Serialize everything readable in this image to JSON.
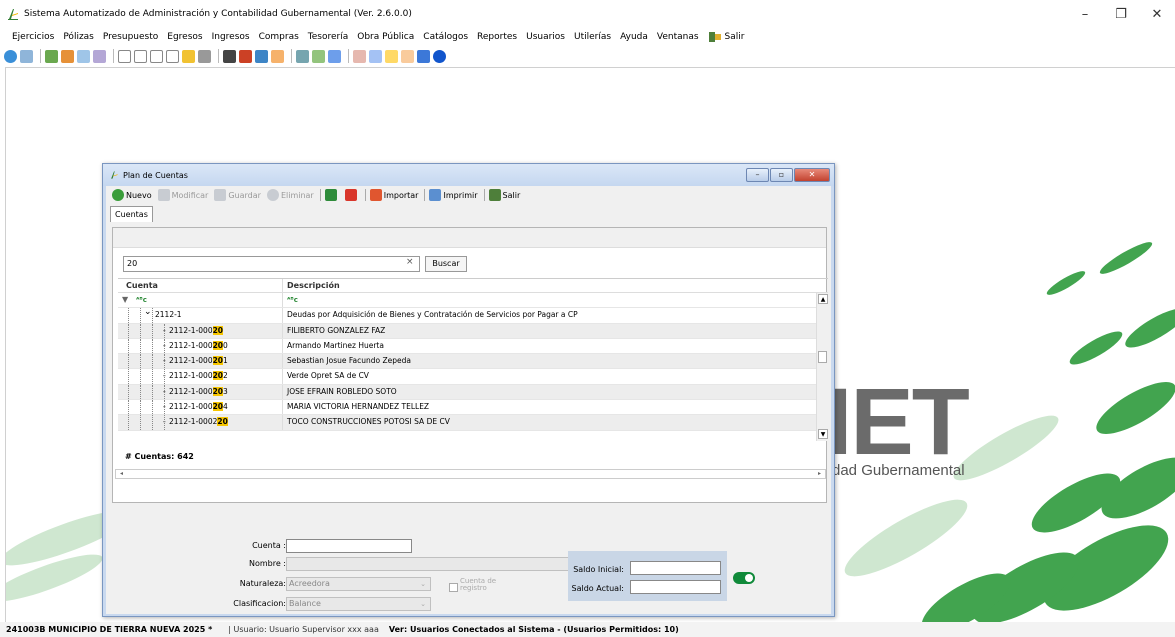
{
  "app": {
    "title": "Sistema Automatizado de Administración y Contabilidad Gubernamental (Ver. 2.6.0.0)"
  },
  "menu": {
    "items": [
      "Ejercicios",
      "Pólizas",
      "Presupuesto",
      "Egresos",
      "Ingresos",
      "Compras",
      "Tesorería",
      "Obra Pública",
      "Catálogos",
      "Reportes",
      "Usuarios",
      "Utilerías",
      "Ayuda",
      "Ventanas"
    ],
    "salir": "Salir"
  },
  "background": {
    "logo_text": "IET",
    "logo_sub": "dad Gubernamental"
  },
  "dialog": {
    "title": "Plan de Cuentas",
    "toolbar": {
      "nuevo": "Nuevo",
      "modificar": "Modificar",
      "guardar": "Guardar",
      "eliminar": "Eliminar",
      "importar": "Importar",
      "imprimir": "Imprimir",
      "salir": "Salir"
    },
    "tab": "Cuentas",
    "search": {
      "value": "20",
      "clear": "×",
      "button": "Buscar"
    },
    "grid": {
      "headers": [
        "Cuenta",
        "Descripción"
      ],
      "filter_cuenta": "ᴬ",
      "rows": [
        {
          "pre": "2112-1",
          "hl": "",
          "post": "",
          "desc": "Deudas por Adquisición de Bienes y Contratación de Servicios por Pagar a CP"
        },
        {
          "pre": "2112-1-000",
          "hl": "20",
          "post": "",
          "desc": "FILIBERTO GONZALEZ FAZ"
        },
        {
          "pre": "2112-1-000",
          "hl": "20",
          "post": "0",
          "desc": "Armando Martinez Huerta"
        },
        {
          "pre": "2112-1-000",
          "hl": "20",
          "post": "1",
          "desc": "Sebastian Josue Facundo Zepeda"
        },
        {
          "pre": "2112-1-000",
          "hl": "20",
          "post": "2",
          "desc": "Verde Opret SA de CV"
        },
        {
          "pre": "2112-1-000",
          "hl": "20",
          "post": "3",
          "desc": "JOSE EFRAIN ROBLEDO SOTO"
        },
        {
          "pre": "2112-1-000",
          "hl": "20",
          "post": "4",
          "desc": "MARIA VICTORIA HERNANDEZ TELLEZ"
        },
        {
          "pre": "2112-1-0002",
          "hl": "20",
          "post": "",
          "desc": "TOCO CONSTRUCCIONES POTOSI SA DE CV"
        }
      ],
      "count": "# Cuentas: 642"
    },
    "form": {
      "cuenta_label": "Cuenta :",
      "cuenta_value": "",
      "nombre_label": "Nombre :",
      "nombre_value": "",
      "naturaleza_label": "Naturaleza:",
      "naturaleza_value": "Acreedora",
      "cuenta_registro": "Cuenta de registro",
      "clasificacion_label": "Clasificacion:",
      "clasificacion_value": "Balance",
      "saldo_inicial_label": "Saldo Inicial:",
      "saldo_inicial_value": "",
      "saldo_actual_label": "Saldo Actual:",
      "saldo_actual_value": ""
    }
  },
  "status": {
    "entity": "241003B MUNICIPIO DE TIERRA NUEVA  2025  *",
    "user": "| Usuario: Usuario Supervisor xxx aaa",
    "connected": "Ver: Usuarios Conectados al Sistema - (Usuarios Permitidos: 10)"
  }
}
